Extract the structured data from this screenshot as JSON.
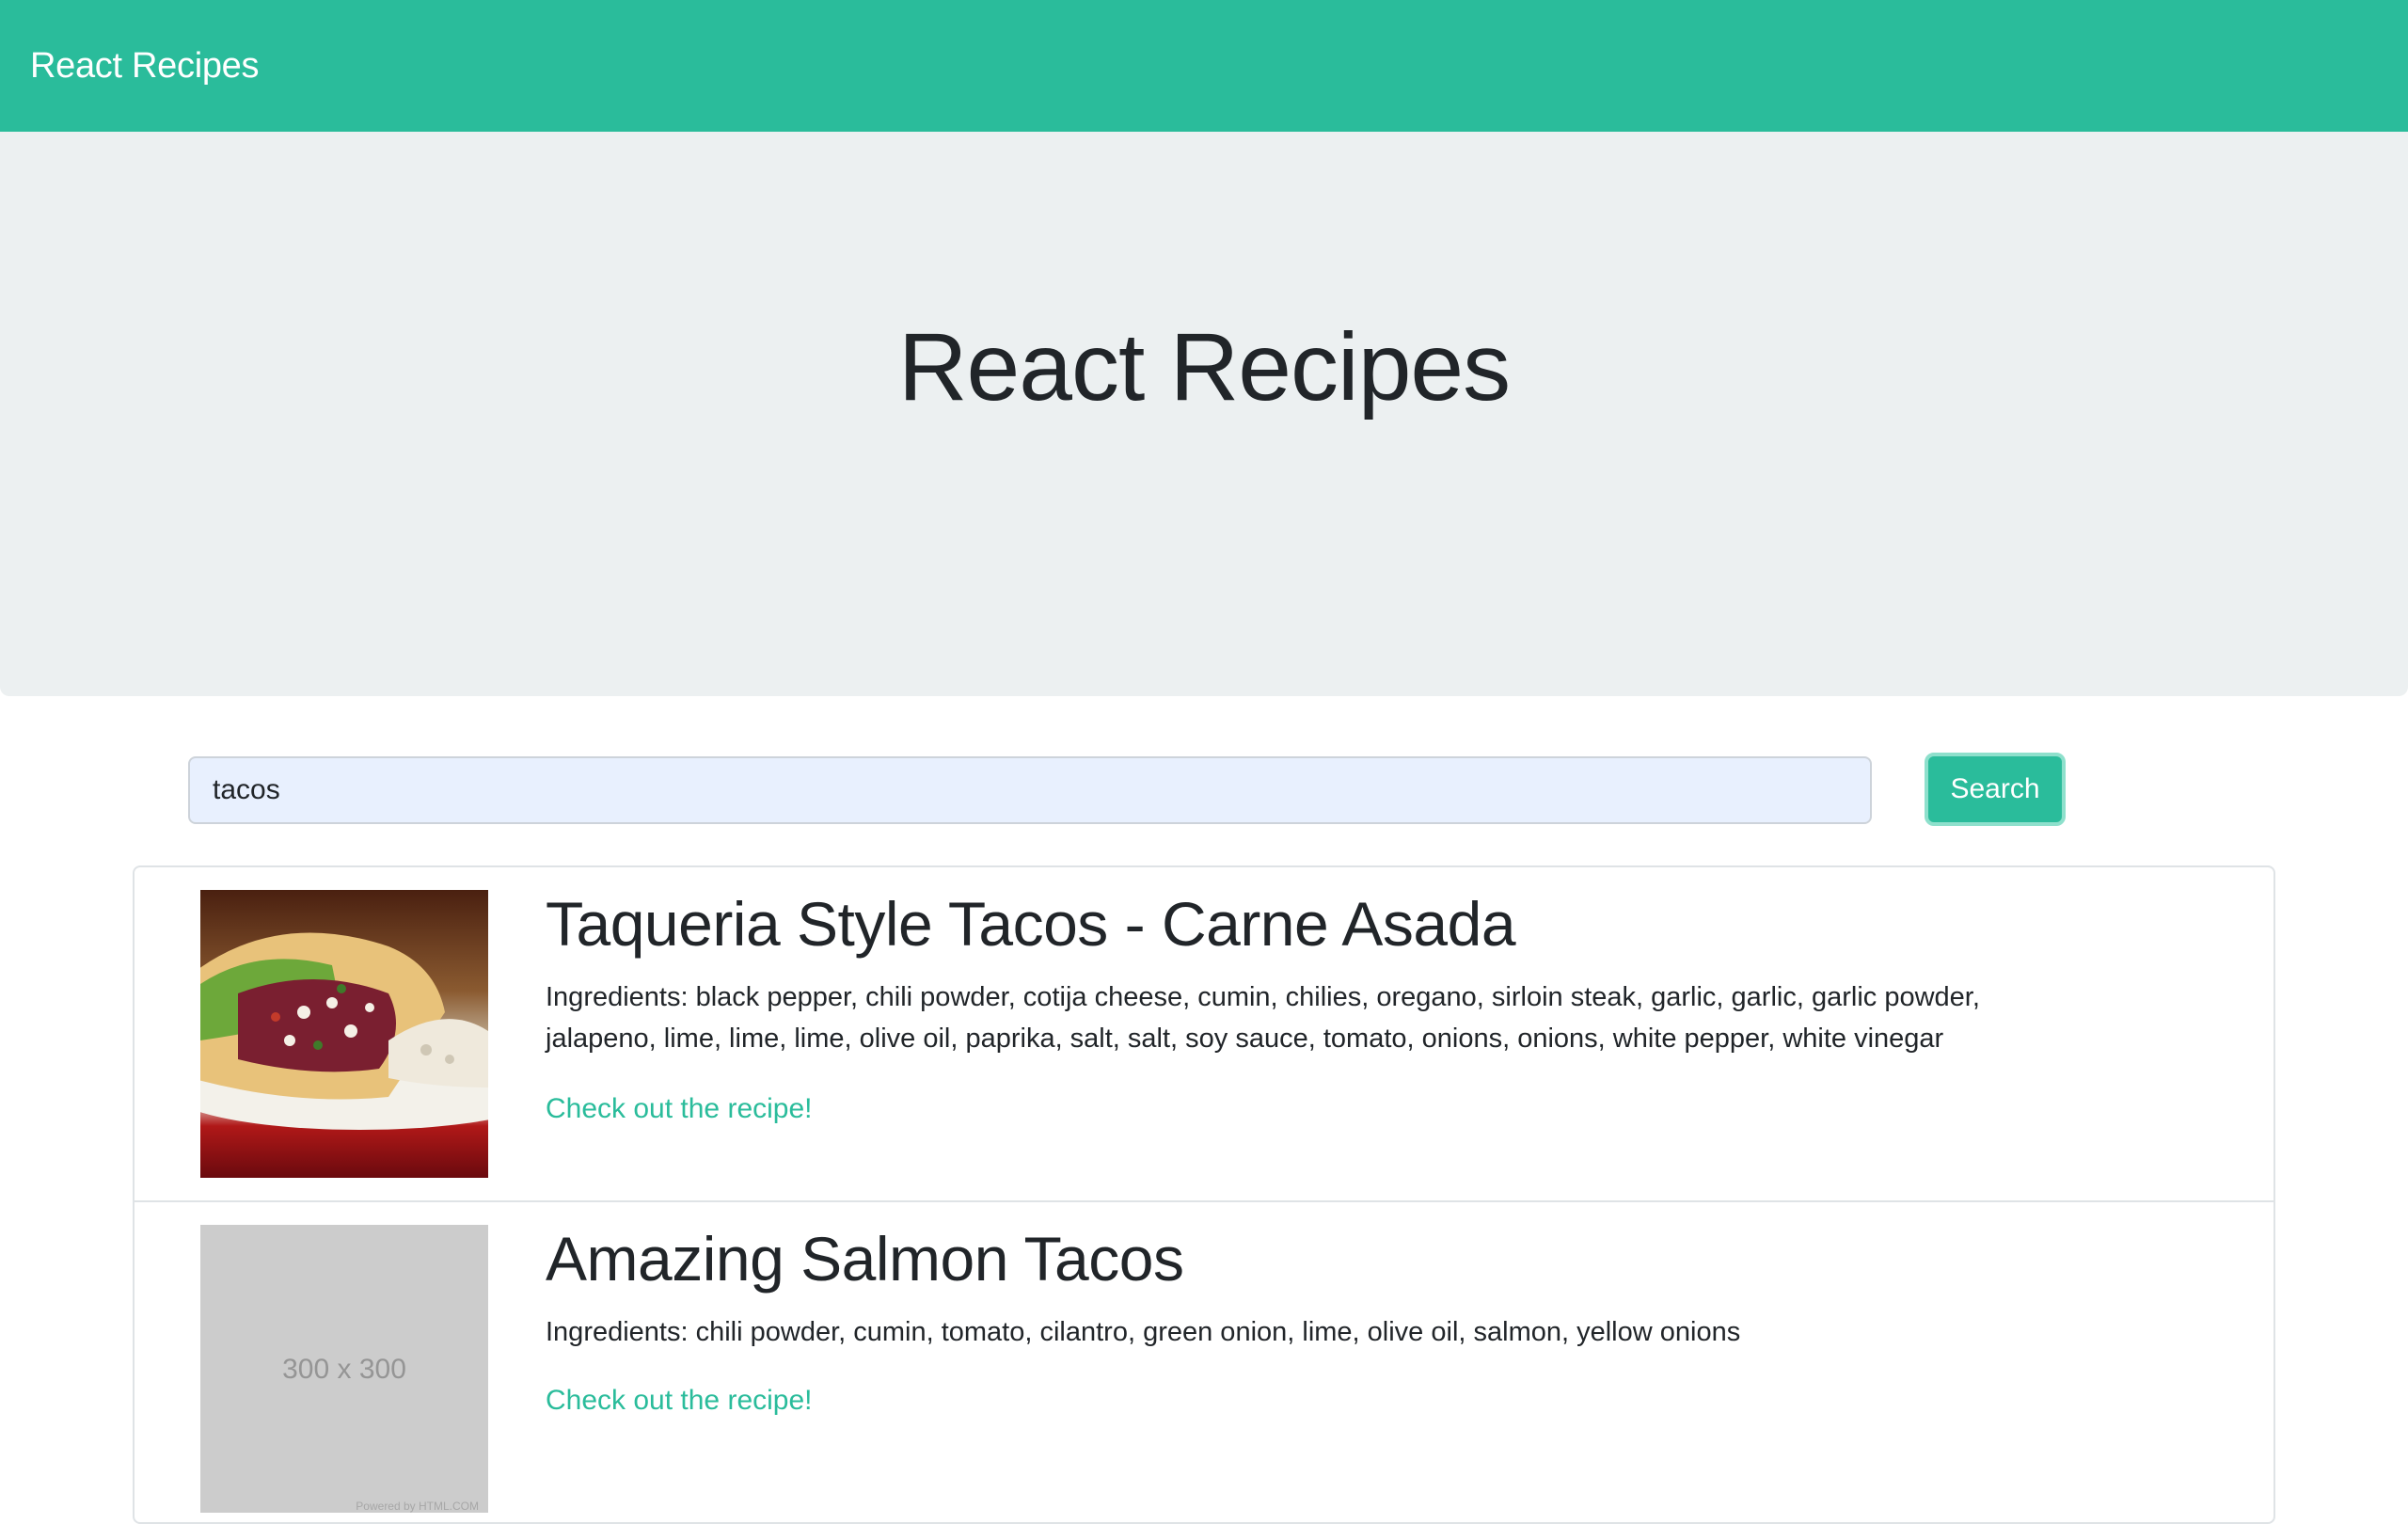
{
  "navbar": {
    "brand": "React Recipes"
  },
  "hero": {
    "title": "React Recipes"
  },
  "search": {
    "value": "tacos",
    "button_label": "Search"
  },
  "results": [
    {
      "title": "Taqueria Style Tacos - Carne Asada",
      "ingredients": "Ingredients: black pepper, chili powder, cotija cheese, cumin, chilies, oregano, sirloin steak, garlic, garlic, garlic powder, jalapeno, lime, lime, lime, olive oil, paprika, salt, salt, soy sauce, tomato, onions, onions, white pepper, white vinegar",
      "link": "Check out the recipe!",
      "image": "taco-photo"
    },
    {
      "title": "Amazing Salmon Tacos",
      "ingredients": "Ingredients: chili powder, cumin, tomato, cilantro, green onion, lime, olive oil, salmon, yellow onions",
      "link": "Check out the recipe!",
      "image": "placeholder",
      "placeholder_label": "300 x 300",
      "placeholder_credit": "Powered by HTML.COM"
    }
  ],
  "colors": {
    "accent": "#2abc9b",
    "hero_bg": "#ecf0f1",
    "input_bg": "#e8f0fe",
    "text": "#212529"
  }
}
